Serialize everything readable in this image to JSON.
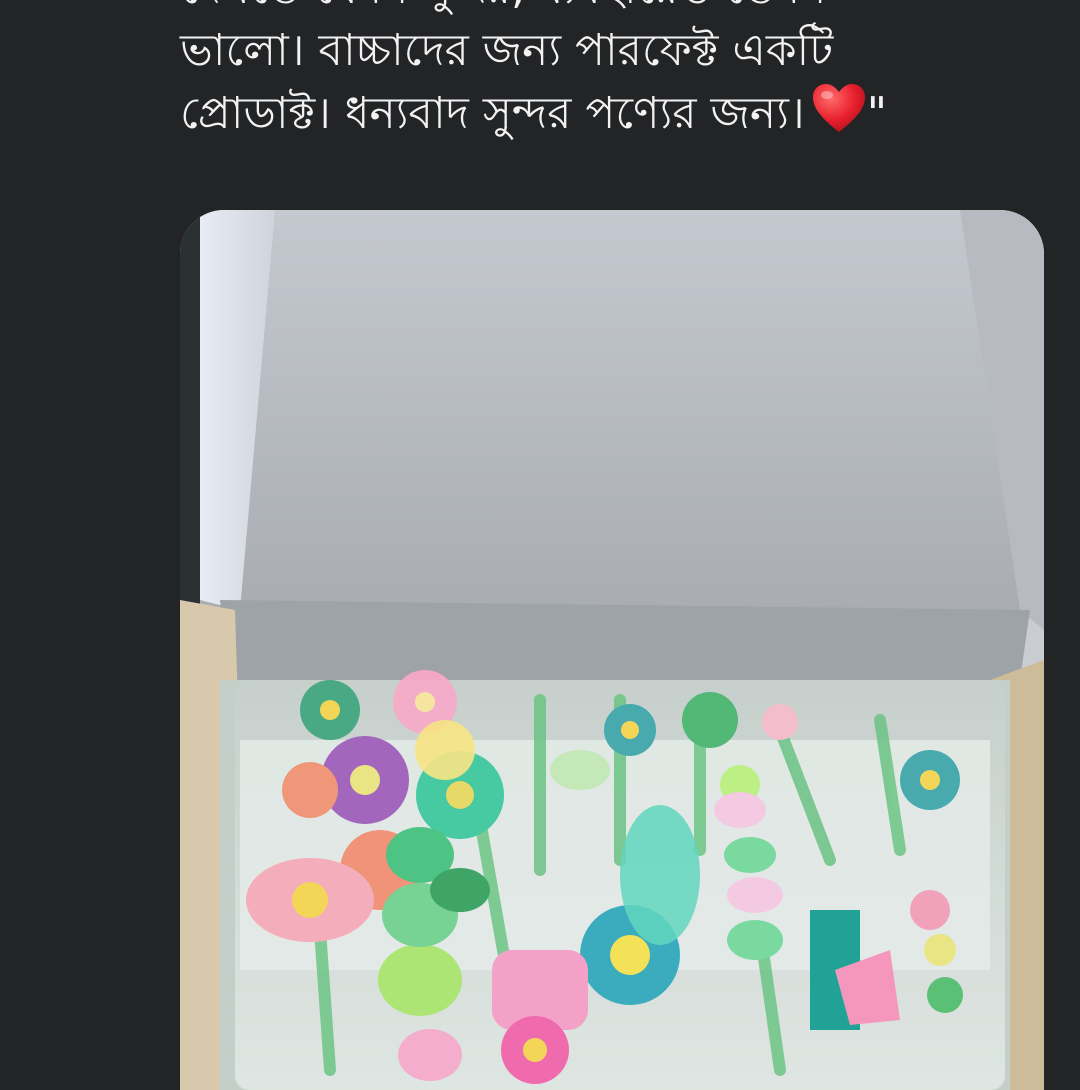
{
  "post": {
    "text_lines": [
      "দেখতে যেমন সুন্দর, ব্যবহারেও তেমন",
      "ভালো। বাচ্চাদের জন্য পারফেক্ট একটি",
      "প্রোডাক্ট। ধন্যবাদ সুন্দর পণ্যের জন্য।"
    ],
    "closing_quote": "\"",
    "emoji": "heart-icon",
    "heart_color": "#e8212e"
  },
  "photo": {
    "description_icon": "product-photo",
    "background": "#232426"
  }
}
